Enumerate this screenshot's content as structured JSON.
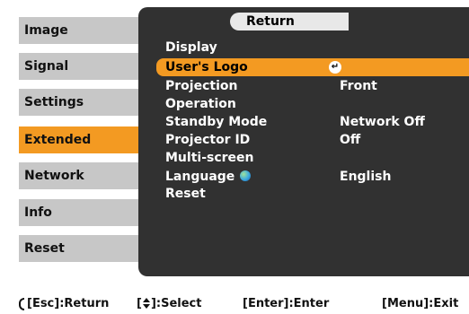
{
  "left_menu": [
    {
      "label": "Image"
    },
    {
      "label": "Signal"
    },
    {
      "label": "Settings"
    },
    {
      "label": "Extended",
      "active": true
    },
    {
      "label": "Network"
    },
    {
      "label": "Info"
    },
    {
      "label": "Reset"
    }
  ],
  "panel": {
    "return_label": "Return",
    "rows": [
      {
        "label": "Display",
        "value": ""
      },
      {
        "label": "User's Logo",
        "value": "",
        "highlighted": true,
        "icon": "enter-icon"
      },
      {
        "label": "Projection",
        "value": "Front"
      },
      {
        "label": "Operation",
        "value": ""
      },
      {
        "label": "Standby Mode",
        "value": "Network Off"
      },
      {
        "label": "Projector ID",
        "value": "Off"
      },
      {
        "label": "Multi-screen",
        "value": ""
      },
      {
        "label": "Language",
        "value": "English",
        "icon": "globe-icon"
      },
      {
        "label": "Reset",
        "value": ""
      }
    ]
  },
  "footer": {
    "esc": "[Esc]:Return",
    "select_left": "[",
    "select_right": "]:Select",
    "enter": "[Enter]:Enter",
    "menu": "[Menu]:Exit"
  },
  "colors": {
    "accent": "#f39a22",
    "panel_bg": "#313131",
    "menu_bg": "#c7c7c7"
  }
}
